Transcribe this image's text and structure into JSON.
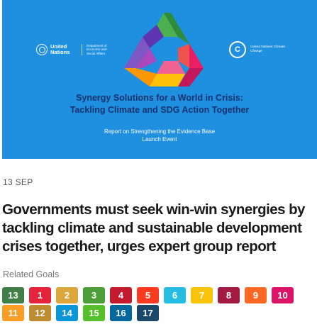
{
  "banner": {
    "un_logo_text": "United Nations",
    "un_dept_text": "Department of Economic and Social Affairs",
    "cc_logo_text": "United Nations Climate Change",
    "title_line1": "Synergy Solutions for a World in Crisis:",
    "title_line2": "Tackling Climate and SDG Action Together",
    "subtitle_line1": "Report on Strengthening the Evidence Base",
    "subtitle_line2": "Launch Event",
    "background_color": "#1f8fe0"
  },
  "article": {
    "date": "13 SEP",
    "headline": "Governments must seek win-win synergies by tackling climate and sustainable development crises together, urges expert group report"
  },
  "related_goals": {
    "label": "Related Goals",
    "goals": [
      {
        "number": "13",
        "color": "#407f46"
      },
      {
        "number": "1",
        "color": "#e5243b"
      },
      {
        "number": "2",
        "color": "#dda63a"
      },
      {
        "number": "3",
        "color": "#4c9f38"
      },
      {
        "number": "4",
        "color": "#c5192d"
      },
      {
        "number": "5",
        "color": "#ff3a21"
      },
      {
        "number": "6",
        "color": "#26bde2"
      },
      {
        "number": "7",
        "color": "#fcc30b"
      },
      {
        "number": "8",
        "color": "#a21942"
      },
      {
        "number": "9",
        "color": "#fd6925"
      },
      {
        "number": "10",
        "color": "#dd1367"
      },
      {
        "number": "11",
        "color": "#fd9d24"
      },
      {
        "number": "12",
        "color": "#bf8b2e"
      },
      {
        "number": "14",
        "color": "#0a97d9"
      },
      {
        "number": "15",
        "color": "#56c02b"
      },
      {
        "number": "16",
        "color": "#00689d"
      },
      {
        "number": "17",
        "color": "#19486a"
      }
    ]
  }
}
